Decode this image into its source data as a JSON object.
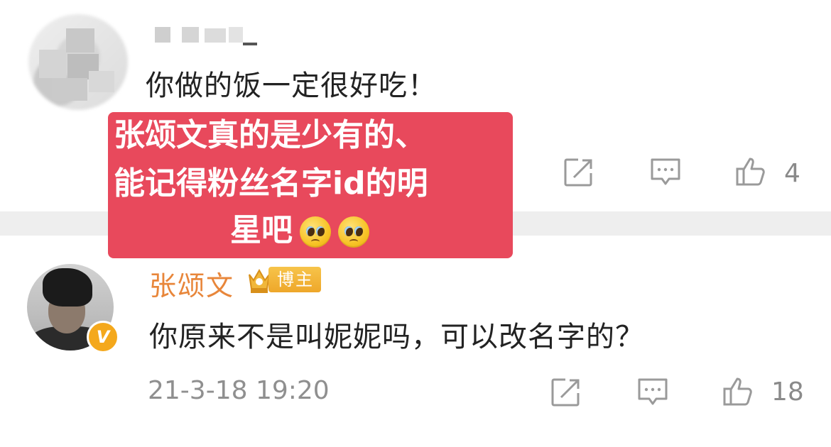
{
  "first_comment": {
    "text": "你做的饭一定很好吃！",
    "like_count": "4",
    "icons": [
      "forward-icon",
      "comment-icon",
      "like-icon"
    ]
  },
  "overlay_caption": {
    "line1": "张颂文真的是少有的、",
    "line2": "能记得粉丝名字id的明",
    "line3": "星吧",
    "emoji": "pleading-face-emoji"
  },
  "reply": {
    "author": "张颂文",
    "badge_label": "博主",
    "verified_mark": "V",
    "text": "你原来不是叫妮妮吗，可以改名字的？",
    "timestamp": "21-3-18 19:20",
    "like_count": "18",
    "icons": [
      "forward-icon",
      "comment-icon",
      "like-icon"
    ]
  },
  "colors": {
    "overlay_bg": "#e8495c",
    "author_name": "#e8863a",
    "badge_bg": "#eea72a",
    "verified_badge": "#f4a81c",
    "divider": "#eeeeee",
    "meta_text": "#8f8f8f"
  }
}
